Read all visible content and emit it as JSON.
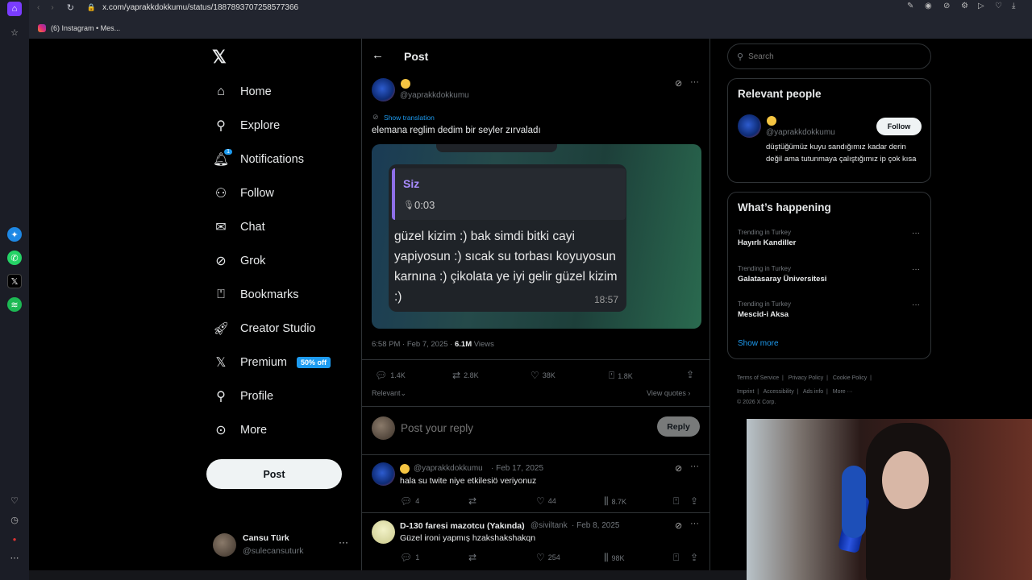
{
  "browser": {
    "url": "x.com/yaprakkdokkumu/status/1887893707258577366",
    "tab_title": "(6) Instagram • Mes..."
  },
  "nav": {
    "items": [
      {
        "label": "Home",
        "icon": "home-icon"
      },
      {
        "label": "Explore",
        "icon": "search-icon"
      },
      {
        "label": "Notifications",
        "icon": "bell-icon",
        "badge": "1"
      },
      {
        "label": "Follow",
        "icon": "add-user-icon"
      },
      {
        "label": "Chat",
        "icon": "mail-icon"
      },
      {
        "label": "Grok",
        "icon": "grok-icon"
      },
      {
        "label": "Bookmarks",
        "icon": "bookmark-icon"
      },
      {
        "label": "Creator Studio",
        "icon": "rocket-icon"
      },
      {
        "label": "Premium",
        "icon": "x-logo-icon",
        "tag": "50% off"
      },
      {
        "label": "Profile",
        "icon": "person-icon"
      },
      {
        "label": "More",
        "icon": "more-circle-icon"
      }
    ],
    "post_button": "Post",
    "account": {
      "name": "Cansu Türk",
      "handle": "@sulecansuturk"
    }
  },
  "header": {
    "title": "Post"
  },
  "tweet": {
    "handle": "@yaprakkdokkumu",
    "show_translation": "Show translation",
    "text": "elemana reglim dedim bir seyler zırvaladı",
    "media": {
      "sender": "Siz",
      "voice_duration": "0:03",
      "message": "güzel kizim :) bak simdi bitki cayi yapiyosun :) sıcak su torbası koyuyosun karnına :) çikolata ye iyi gelir güzel kizim :)",
      "time": "18:57"
    },
    "timestamp": "6:58 PM · Feb 7, 2025 · ",
    "views_count": "6.1M",
    "views_label": "Views",
    "replies": "1.4K",
    "reposts": "2.8K",
    "likes": "38K",
    "bookmarks": "1.8K",
    "sort_label": "Relevant",
    "view_quotes": "View quotes"
  },
  "reply_box": {
    "placeholder": "Post your reply",
    "button": "Reply"
  },
  "replies": [
    {
      "name": "",
      "handle": "@yaprakkdokkumu",
      "date": "· Feb 17, 2025",
      "text": "hala su twite niye etkilesiö veriyonuz",
      "replies": "4",
      "reposts": "",
      "likes": "44",
      "views": "8.7K"
    },
    {
      "name": "D-130 faresi mazotcu (Yakında)",
      "handle": "@siviltank",
      "date": "· Feb 8, 2025",
      "text": "Güzel ironi yapmış hzakshakshakqn",
      "replies": "1",
      "reposts": "",
      "likes": "254",
      "views": "98K"
    }
  ],
  "right": {
    "search_placeholder": "Search",
    "relevant_title": "Relevant people",
    "person": {
      "handle": "@yaprakkdokkumu",
      "bio": "düştüğümüz kuyu sandığımız kadar derin değil ama tutunmaya çalıştığımız ip çok kısa",
      "follow": "Follow"
    },
    "happening_title": "What’s happening",
    "trends": [
      {
        "context": "Trending in Turkey",
        "name": "Hayırlı Kandiller"
      },
      {
        "context": "Trending in Turkey",
        "name": "Galatasaray Üniversitesi"
      },
      {
        "context": "Trending in Turkey",
        "name": "Mescid-i Aksa"
      }
    ],
    "show_more": "Show more",
    "footer": {
      "row1": [
        "Terms of Service",
        "Privacy Policy",
        "Cookie Policy"
      ],
      "row2": [
        "Imprint",
        "Accessibility",
        "Ads info",
        "More ···"
      ],
      "copyright": "© 2026 X Corp."
    }
  },
  "colors": {
    "accent": "#1d9bf0",
    "background": "#000000",
    "border": "#2f3336",
    "muted": "#71767b",
    "quote_bar": "#8e6fe8"
  }
}
